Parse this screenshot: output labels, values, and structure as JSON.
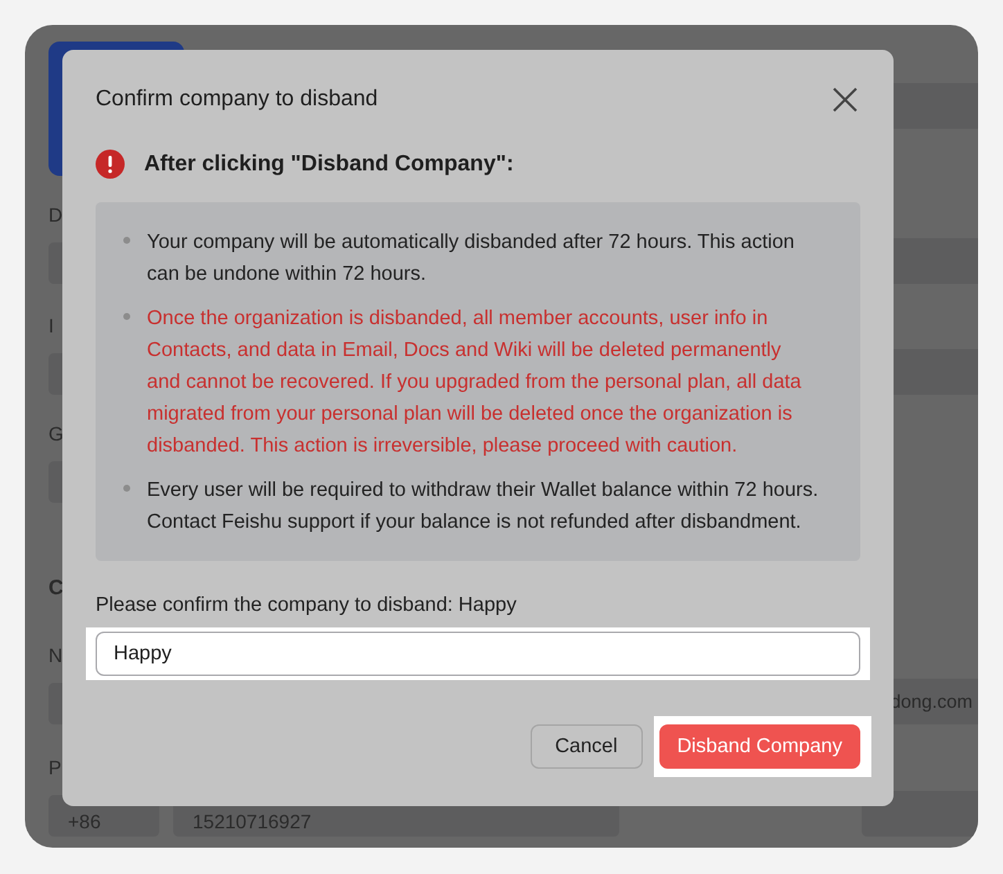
{
  "background_page": {
    "groups": [
      {
        "kind": "field",
        "label": "D",
        "right_field": true
      },
      {
        "kind": "field",
        "label": "I",
        "right_field": true
      },
      {
        "kind": "field",
        "label": "G",
        "right_field": false
      },
      {
        "kind": "heading",
        "label": "C"
      },
      {
        "kind": "field",
        "label": "N",
        "right_field": true,
        "right_text": "dong.com"
      },
      {
        "kind": "field",
        "label": "P",
        "left_fields": [
          "+86",
          "15210716927"
        ],
        "right_field": true
      }
    ]
  },
  "dialog": {
    "title": "Confirm company to disband",
    "warning": "After clicking \"Disband Company\":",
    "notes": [
      {
        "kind": "normal",
        "text": "Your company will be automatically disbanded after 72 hours. This action can be undone within 72 hours."
      },
      {
        "kind": "danger",
        "text": "Once the organization is disbanded, all member accounts, user info in Contacts, and data in Email, Docs and Wiki will be deleted permanently and cannot be recovered. If you upgraded from the personal plan, all data migrated from your personal plan will be deleted once the organization is disbanded. This action is irreversible, please proceed with caution."
      },
      {
        "kind": "normal",
        "text": "Every user will be required to withdraw their Wallet balance within 72 hours. Contact Feishu support if your balance is not refunded after disbandment."
      }
    ],
    "confirm_label": "Please confirm the company to disband:",
    "company_name": "Happy",
    "input": {
      "value": "Happy",
      "highlighted": true
    },
    "buttons": [
      {
        "kind": "secondary",
        "label": "Cancel",
        "highlighted": false
      },
      {
        "kind": "danger",
        "label": "Disband Company",
        "highlighted": true
      }
    ]
  }
}
